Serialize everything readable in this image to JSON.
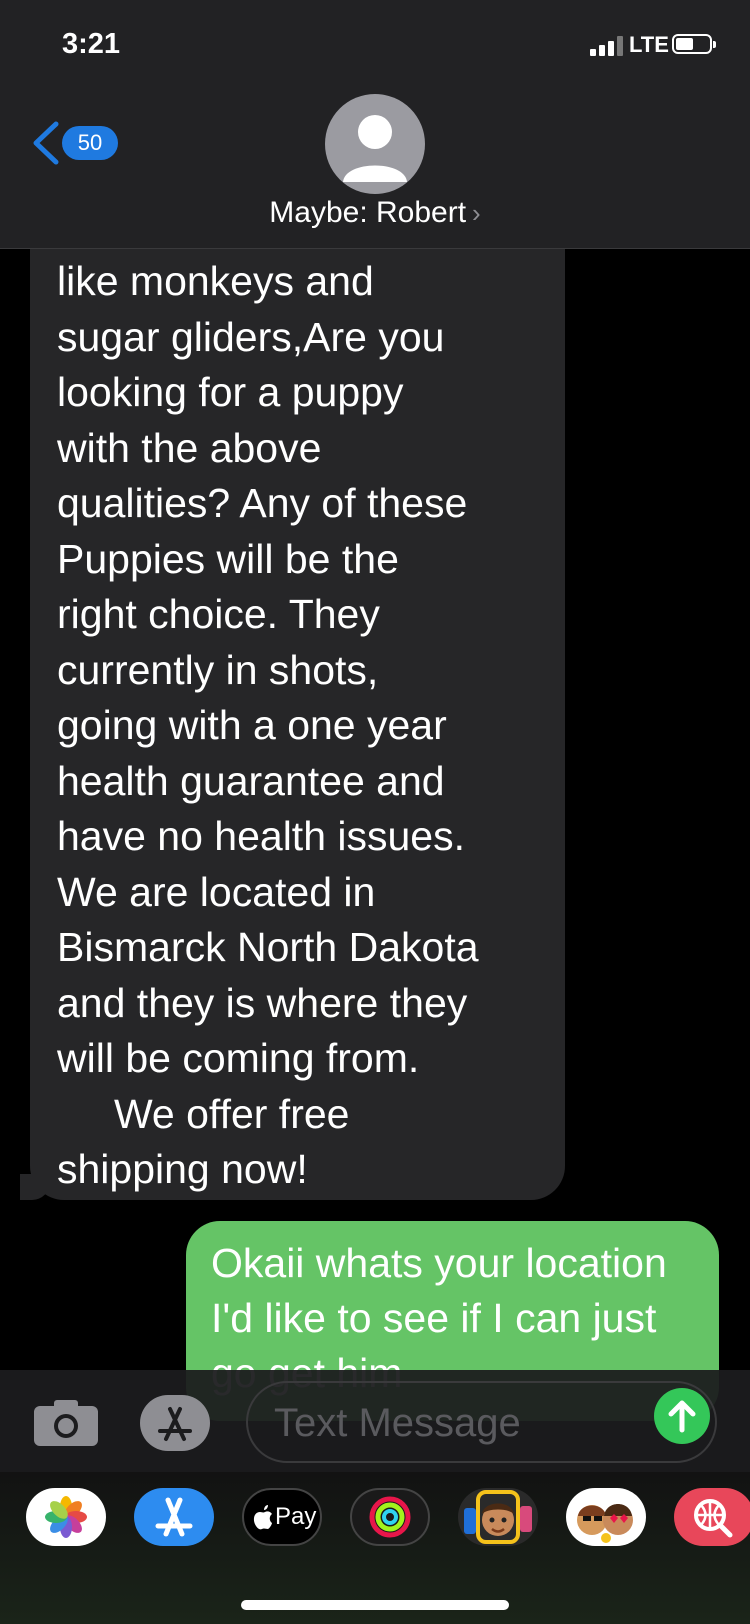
{
  "status": {
    "time": "3:21",
    "network": "LTE"
  },
  "header": {
    "back_count": "50",
    "contact_name": "Maybe: Robert",
    "chevron": "›"
  },
  "messages": {
    "incoming": "like monkeys and\nsugar gliders,Are you\nlooking for a puppy\nwith the above\nqualities? Any of these\nPuppies will be the\nright choice. They\ncurrently in shots,\ngoing with a one year\nhealth guarantee and\nhave no health issues.\nWe are located in\nBismarck North Dakota\nand they is where they\nwill be coming from.\n     We offer free\nshipping now!",
    "outgoing": "Okaii whats your location I'd like to see if I can just go get him"
  },
  "composer": {
    "placeholder": "Text Message"
  },
  "apps": [
    "photos-app",
    "app-store-app",
    "apple-pay-app",
    "activity-app",
    "memoji-app",
    "memoji-stickers-app",
    "web-images-app"
  ],
  "apps_labels": {
    "apple_pay": "Pay"
  }
}
